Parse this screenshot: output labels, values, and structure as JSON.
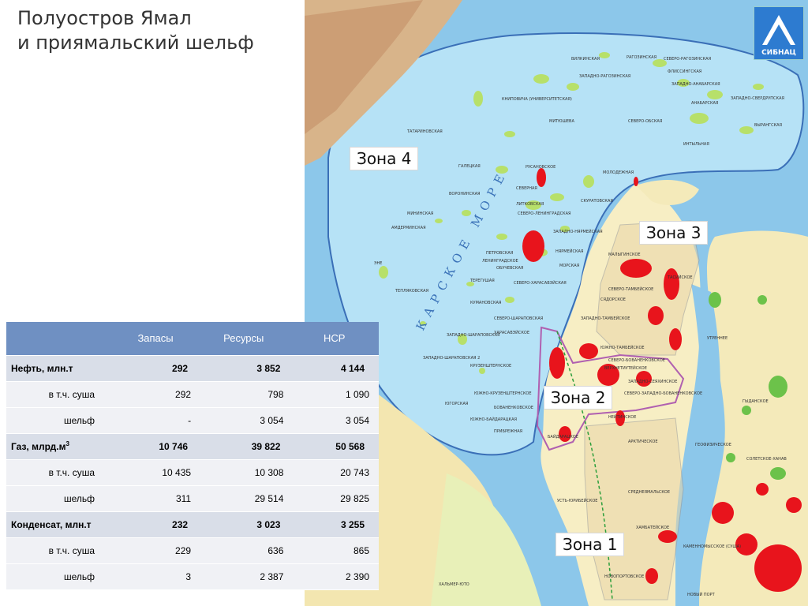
{
  "title": [
    "Полуостров Ямал",
    "и приямальский шельф"
  ],
  "logo_text": "СИБНАЦ",
  "sea_label": "КАРСКОЕ МОРЕ",
  "zones": [
    "Зона 4",
    "Зона 3",
    "Зона 2",
    "Зона 1"
  ],
  "fields": [
    "РАГОЗИНСКАЯ",
    "СЕВЕРО-РАГОЗИНСКАЯ",
    "ВИЛКИНСКАЯ",
    "ЗАПАДНО-РАГОЗИНСКАЯ",
    "ФЛИССИНГСКАЯ",
    "ЗАПАДНО-АНАБАРСКАЯ",
    "ЗАПАДНО-СВЕРДРУПСКАЯ",
    "КНИПОВИЧА (УНИВЕРСИТЕТСКАЯ)",
    "АНАБАРСКАЯ",
    "МИТЮШЕВА",
    "СЕВЕРО-ОБСКАЯ",
    "ВЫРАНГСКАЯ",
    "ТАТАРИНОВСКАЯ",
    "ИНТЫЛЬНАЯ",
    "РУСАНОВСКОЕ",
    "МОЛОДЕЖНАЯ",
    "ГАЛЕЦКАЯ",
    "ВОРОНИНСКАЯ",
    "СЕВЕРНАЯ",
    "ЛИТКОВСКАЯ",
    "СКУРАТОВСКАЯ",
    "СЕВЕРО-ЛЕНИНГРАДСКАЯ",
    "ЗАПАДНО-НЯРМЕЙСКАЯ",
    "НЯРМЕЙСКАЯ",
    "ЛЕНИНГРАДСКОЕ",
    "ПЕТРОВСКАЯ",
    "МОРСКАЯ",
    "ОБУЧЕВСКАЯ",
    "ТЕРЕГУШАЯ",
    "СЕВЕРО-ХАРАСАВЭЙСКАЯ",
    "КУМАНОВСКАЯ",
    "МАЛЫГИНСКОЕ",
    "ТАСИЙСКОЕ",
    "СЕВЕРО-ТАМБЕЙСКОЕ",
    "СЯДОРСКОЕ",
    "ЗАПАДНО-ТАМБЕЙСКОЕ",
    "ЮЖНО-ТАМБЕЙСКОЕ",
    "УТРЕННЕЕ",
    "ХАРАСАВЭЙСКОЕ",
    "КРУЗЕНШТЕРНСКОЕ",
    "СЕВЕРО-БОВАНЕНКОВСКОЕ",
    "ВЕРХНЕТИУТЕЙСКОЕ",
    "ЗАПАДНО-СЕЯХИНСКОЕ",
    "СЕВЕРО-ЗАПАДНО-БОВАНЕНКОВСКОЕ",
    "ЮЖНО-КРУЗЕНШТЕРНСКОЕ",
    "БОВАНЕНКОВСКОЕ",
    "НЕЙТИНСКОЕ",
    "ГЫДАНСКОЕ",
    "БАЙДАРАЦКОЕ",
    "АРКТИЧЕСКОЕ",
    "ГЕОФИЗИЧЕСКОЕ",
    "СОЛЕТСКОЕ-ХАНАВ",
    "СРЕДНЕЯМАЛЬСКОЕ",
    "УСТЬ-ЮРИБЕЙСКОЕ",
    "ХАМБАТЕЙСКОЕ",
    "КАМЕННОМЫССКОЕ (СУША)",
    "НОВОПОРТОВСКОЕ",
    "НОВЫЙ ПОРТ",
    "ХАЛЬМЕР-ЮТО",
    "ЮЖНО-БАЙДАРАЦКАЯ",
    "ЮГОРСКАЯ",
    "ПРИБРЕЖНАЯ",
    "ЗАПАДНО-ШАРАПОВСКАЯ",
    "СЕВЕРО-ШАРАПОВСКАЯ",
    "МИНИНСКАЯ",
    "ЭНЕ",
    "ТЕПЛЯКОВСКАЯ",
    "ЗАПАДНО-ШАРАПОВСКАЯ 2",
    "АМДЕРМИНСКАЯ"
  ],
  "table": {
    "headers": [
      "",
      "Запасы",
      "Ресурсы",
      "НСР"
    ],
    "rows": [
      {
        "label": "Нефть, млн.т",
        "type": "main",
        "values": [
          "292",
          "3 852",
          "4 144"
        ]
      },
      {
        "label": "в т.ч. суша",
        "type": "sub",
        "values": [
          "292",
          "798",
          "1 090"
        ]
      },
      {
        "label": "шельф",
        "type": "sub",
        "values": [
          "-",
          "3 054",
          "3 054"
        ]
      },
      {
        "label": "Газ, млрд.м",
        "sup": "3",
        "type": "main",
        "values": [
          "10 746",
          "39 822",
          "50 568"
        ]
      },
      {
        "label": "в т.ч. суша",
        "type": "sub",
        "values": [
          "10 435",
          "10 308",
          "20 743"
        ]
      },
      {
        "label": "шельф",
        "type": "sub",
        "values": [
          "311",
          "29 514",
          "29 825"
        ]
      },
      {
        "label": "Конденсат, млн.т",
        "type": "main",
        "values": [
          "232",
          "3 023",
          "3 255"
        ]
      },
      {
        "label": "в т.ч. суша",
        "type": "sub",
        "values": [
          "229",
          "636",
          "865"
        ]
      },
      {
        "label": "шельф",
        "type": "sub",
        "values": [
          "3",
          "2 387",
          "2 390"
        ]
      }
    ]
  }
}
